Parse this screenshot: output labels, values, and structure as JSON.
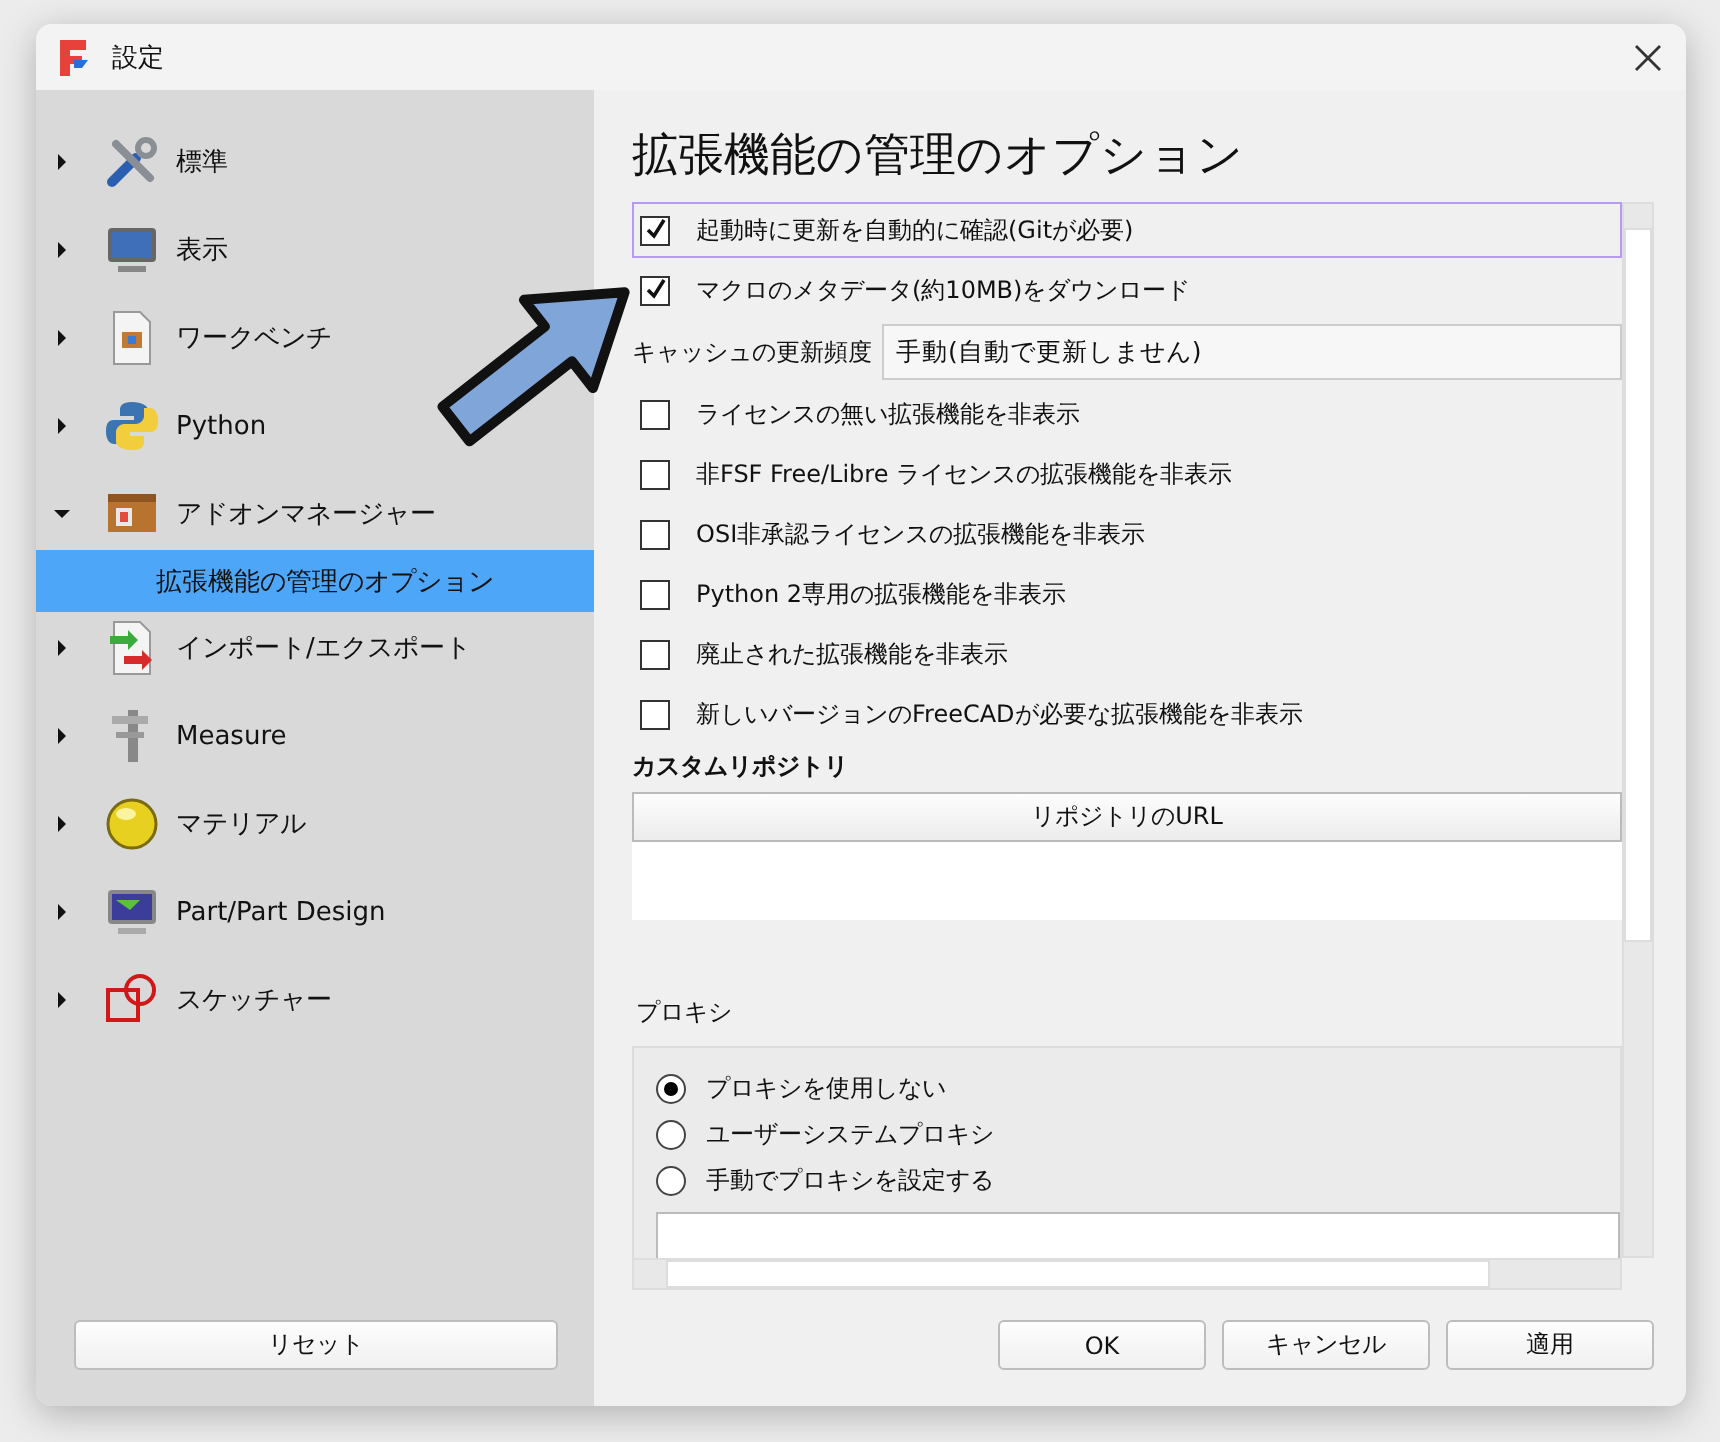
{
  "window": {
    "title": "設定"
  },
  "sidebar": {
    "items": [
      {
        "label": "標準",
        "expanded": false,
        "selected": false
      },
      {
        "label": "表示",
        "expanded": false,
        "selected": false
      },
      {
        "label": "ワークベンチ",
        "expanded": false,
        "selected": false
      },
      {
        "label": "Python",
        "expanded": false,
        "selected": false
      },
      {
        "label": "アドオンマネージャー",
        "expanded": true,
        "selected": false,
        "children": [
          {
            "label": "拡張機能の管理のオプション",
            "selected": true
          }
        ]
      },
      {
        "label": "インポート/エクスポート",
        "expanded": false,
        "selected": false
      },
      {
        "label": "Measure",
        "expanded": false,
        "selected": false
      },
      {
        "label": "マテリアル",
        "expanded": false,
        "selected": false
      },
      {
        "label": "Part/Part Design",
        "expanded": false,
        "selected": false
      },
      {
        "label": "スケッチャー",
        "expanded": false,
        "selected": false
      }
    ]
  },
  "reset_button": "リセット",
  "panel": {
    "title": "拡張機能の管理のオプション",
    "options": [
      {
        "kind": "checkbox",
        "label": "起動時に更新を自動的に確認(Gitが必要)",
        "checked": true,
        "focused": true
      },
      {
        "kind": "checkbox",
        "label": "マクロのメタデータ(約10MB)をダウンロード",
        "checked": true,
        "focused": false
      },
      {
        "kind": "combo",
        "label": "キャッシュの更新頻度",
        "value": "手動(自動で更新しません)"
      },
      {
        "kind": "checkbox",
        "label": "ライセンスの無い拡張機能を非表示",
        "checked": false,
        "focused": false
      },
      {
        "kind": "checkbox",
        "label": "非FSF Free/Libre ライセンスの拡張機能を非表示",
        "checked": false,
        "focused": false
      },
      {
        "kind": "checkbox",
        "label": "OSI非承認ライセンスの拡張機能を非表示",
        "checked": false,
        "focused": false
      },
      {
        "kind": "checkbox",
        "label": "Python 2専用の拡張機能を非表示",
        "checked": false,
        "focused": false
      },
      {
        "kind": "checkbox",
        "label": "廃止された拡張機能を非表示",
        "checked": false,
        "focused": false
      },
      {
        "kind": "checkbox",
        "label": "新しいバージョンのFreeCADが必要な拡張機能を非表示",
        "checked": false,
        "focused": false
      }
    ],
    "custom_repositories": {
      "heading": "カスタムリポジトリ",
      "columns": [
        "リポジトリのURL"
      ]
    },
    "proxy": {
      "heading": "プロキシ",
      "options": [
        {
          "label": "プロキシを使用しない",
          "selected": true
        },
        {
          "label": "ユーザーシステムプロキシ",
          "selected": false
        },
        {
          "label": "手動でプロキシを設定する",
          "selected": false
        }
      ]
    }
  },
  "buttons": [
    "OK",
    "キャンセル",
    "適用"
  ]
}
